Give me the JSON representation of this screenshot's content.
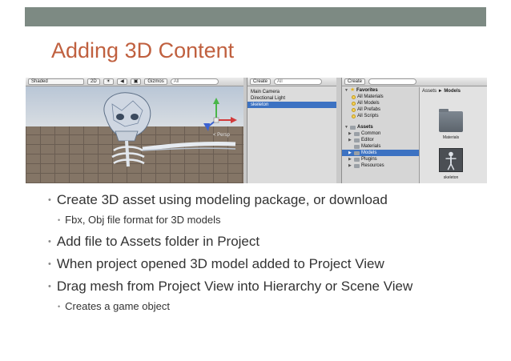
{
  "slide": {
    "title": "Adding 3D Content"
  },
  "screenshot": {
    "scene": {
      "shading_mode": "Shaded",
      "mode_2d": "2D",
      "gizmos": "Gizmos",
      "search_placeholder": "All",
      "persp_label": "< Persp"
    },
    "hierarchy": {
      "create": "Create",
      "search_placeholder": "All",
      "items": [
        {
          "label": "Main Camera",
          "selected": false
        },
        {
          "label": "Directional Light",
          "selected": false
        },
        {
          "label": "skeleton",
          "selected": true
        }
      ]
    },
    "project": {
      "create": "Create",
      "breadcrumb_root": "Assets",
      "breadcrumb_sep": "►",
      "breadcrumb_current": "Models",
      "favorites": {
        "label": "Favorites",
        "items": [
          "All Materials",
          "All Models",
          "All Prefabs",
          "All Scripts"
        ]
      },
      "assets": {
        "label": "Assets",
        "items": [
          {
            "label": "Common",
            "selected": false
          },
          {
            "label": "Editor",
            "selected": false
          },
          {
            "label": "Materials",
            "selected": false
          },
          {
            "label": "Models",
            "selected": true
          },
          {
            "label": "Plugins",
            "selected": false
          },
          {
            "label": "Resources",
            "selected": false
          }
        ]
      },
      "grid": [
        {
          "label": "Materials"
        },
        {
          "label": "skeleton"
        }
      ]
    }
  },
  "bullets": [
    {
      "level": 1,
      "text": "Create 3D asset using modeling package, or download"
    },
    {
      "level": 2,
      "text": "Fbx, Obj file format for 3D models"
    },
    {
      "level": 1,
      "text": "Add file to Assets folder in Project"
    },
    {
      "level": 1,
      "text": "When project opened 3D model added to Project View"
    },
    {
      "level": 1,
      "text": "Drag mesh from Project View into Hierarchy or Scene View"
    },
    {
      "level": 2,
      "text": "Creates a game object"
    }
  ],
  "colors": {
    "title": "#c0603f",
    "top_bar": "#7d8a83",
    "selection": "#3c72c2",
    "body_text": "#333333"
  }
}
